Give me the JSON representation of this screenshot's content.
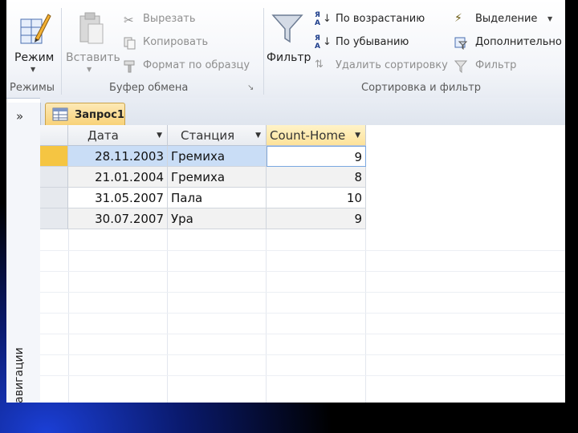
{
  "ribbon": {
    "views": {
      "mode_label": "Режим",
      "group_label": "Режимы"
    },
    "clipboard": {
      "paste_label": "Вставить",
      "cut_label": "Вырезать",
      "copy_label": "Копировать",
      "format_painter_label": "Формат по образцу",
      "group_label": "Буфер обмена"
    },
    "sort_filter": {
      "filter_label": "Фильтр",
      "ascending_label": "По возрастанию",
      "descending_label": "По убыванию",
      "remove_sort_label": "Удалить сортировку",
      "selection_label": "Выделение",
      "advanced_label": "Дополнительно",
      "toggle_filter_label": "Фильтр",
      "group_label": "Сортировка и фильтр"
    }
  },
  "nav": {
    "toggle": "»",
    "label": "навигации"
  },
  "tab": {
    "label": "Запрос1"
  },
  "table": {
    "columns": [
      "Дата",
      "Станция",
      "Count-Home"
    ],
    "rows": [
      [
        "28.11.2003",
        "Гремиха",
        "9"
      ],
      [
        "21.01.2004",
        "Гремиха",
        "8"
      ],
      [
        "31.05.2007",
        "Пала",
        "10"
      ],
      [
        "30.07.2007",
        "Ура",
        "9"
      ]
    ]
  },
  "colors": {
    "selected_row": "#c9ddf6",
    "tab_accent": "#f8d176",
    "active_header": "#fde9a8",
    "record_selector_active": "#f5c542"
  }
}
